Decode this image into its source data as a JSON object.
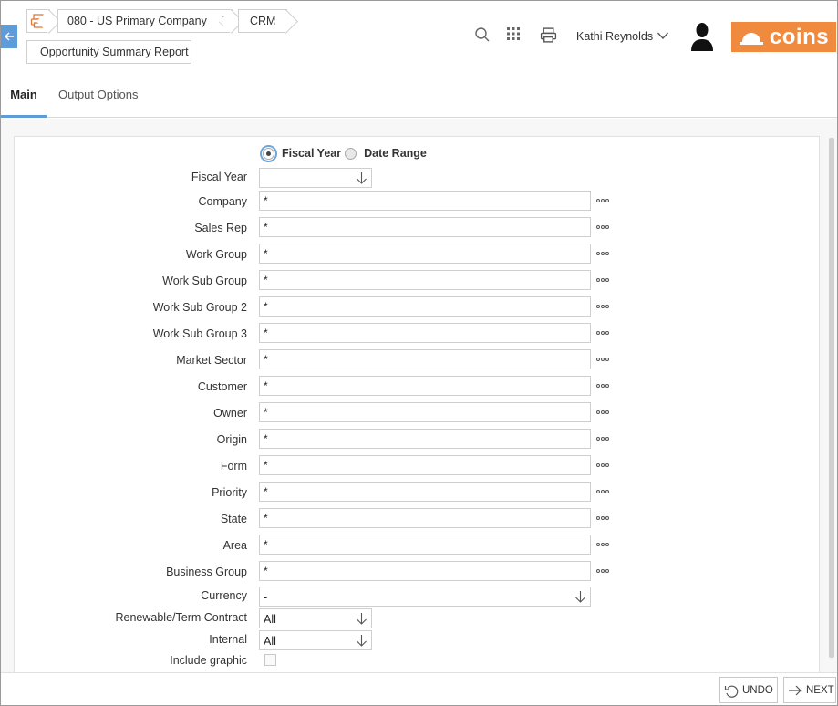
{
  "breadcrumb": {
    "company": "080 - US Primary Company",
    "module": "CRM",
    "report": "Opportunity Summary Report"
  },
  "header": {
    "user_name": "Kathi Reynolds",
    "logo_text": "coins",
    "icons": [
      "print-icon",
      "search-icon",
      "apps-grid-icon",
      "print-icon",
      "chevron-down-icon",
      "user-avatar-icon"
    ]
  },
  "tabs": [
    {
      "label": "Main",
      "active": true
    },
    {
      "label": "Output Options",
      "active": false
    }
  ],
  "period": {
    "options": [
      {
        "label": "Fiscal Year",
        "selected": true
      },
      {
        "label": "Date Range",
        "selected": false
      }
    ]
  },
  "form": {
    "fiscal_year": {
      "label": "Fiscal Year",
      "value": ""
    },
    "fields": [
      {
        "label": "Company",
        "value": "*"
      },
      {
        "label": "Sales Rep",
        "value": "*"
      },
      {
        "label": "Work Group",
        "value": "*"
      },
      {
        "label": "Work Sub Group",
        "value": "*"
      },
      {
        "label": "Work Sub Group 2",
        "value": "*"
      },
      {
        "label": "Work Sub Group 3",
        "value": "*"
      },
      {
        "label": "Market Sector",
        "value": "*"
      },
      {
        "label": "Customer",
        "value": "*"
      },
      {
        "label": "Owner",
        "value": "*"
      },
      {
        "label": "Origin",
        "value": "*"
      },
      {
        "label": "Form",
        "value": "*"
      },
      {
        "label": "Priority",
        "value": "*"
      },
      {
        "label": "State",
        "value": "*"
      },
      {
        "label": "Area",
        "value": "*"
      },
      {
        "label": "Business Group",
        "value": "*"
      }
    ],
    "currency": {
      "label": "Currency",
      "value": "-"
    },
    "renewable": {
      "label": "Renewable/Term Contract",
      "value": "All"
    },
    "internal": {
      "label": "Internal",
      "value": "All"
    },
    "include_graphic": {
      "label": "Include graphic",
      "checked": false
    }
  },
  "footer": {
    "undo_label": "UNDO",
    "next_label": "NEXT"
  },
  "colors": {
    "accent": "#5d9cd8",
    "brand": "#f08a3e"
  }
}
